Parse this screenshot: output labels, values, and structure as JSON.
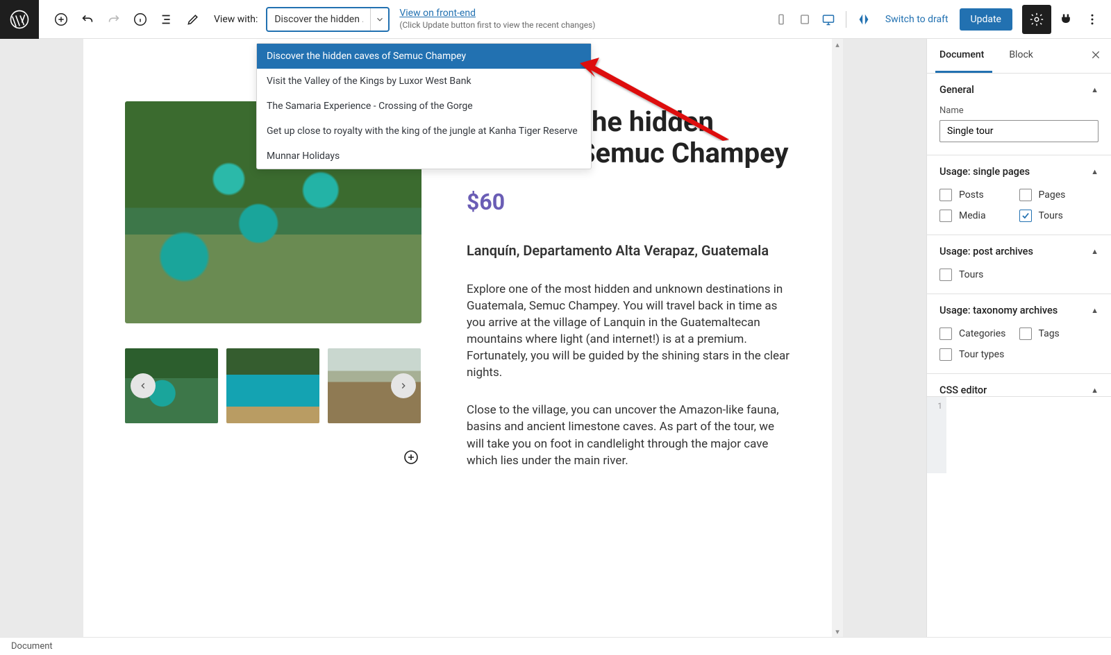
{
  "toolbar": {
    "view_with_label": "View with:",
    "combo_value": "Discover the hidden …",
    "view_frontend": "View on front-end",
    "view_hint": "(Click Update button first to view the recent changes)",
    "switch_draft": "Switch to draft",
    "update": "Update"
  },
  "dropdown": {
    "options": [
      "Discover the hidden caves of Semuc Champey",
      "Visit the Valley of the Kings by Luxor West Bank",
      "The Samaria Experience - Crossing of the Gorge",
      "Get up close to royalty with the king of the jungle at Kanha Tiger Reserve",
      "Munnar Holidays"
    ],
    "selected_index": 0
  },
  "content": {
    "title": "Discover the hidden caves of Semuc Champey",
    "price": "$60",
    "location": "Lanquín, Departamento Alta Verapaz, Guatemala",
    "para1": "Explore one of the most hidden and unknown destinations in Guatemala, Semuc Champey. You will travel back in time as you arrive at the village of Lanquin in the Guatemaltecan mountains where light (and internet!) is at a premium. Fortunately, you will be guided by the shining stars in the clear nights.",
    "para2": "Close to the village, you can uncover the Amazon-like fauna, basins and ancient limestone caves. As part of the tour, we will take you on foot in candlelight through the major cave which lies under the main river."
  },
  "sidebar": {
    "tabs": {
      "document": "Document",
      "block": "Block"
    },
    "general": {
      "title": "General",
      "name_label": "Name",
      "name_value": "Single tour"
    },
    "usage_single": {
      "title": "Usage: single pages",
      "posts": "Posts",
      "pages": "Pages",
      "media": "Media",
      "tours": "Tours"
    },
    "usage_post": {
      "title": "Usage: post archives",
      "tours": "Tours"
    },
    "usage_taxonomy": {
      "title": "Usage: taxonomy archives",
      "categories": "Categories",
      "tags": "Tags",
      "tour_types": "Tour types"
    },
    "css_editor": {
      "title": "CSS editor",
      "line_no": "1"
    }
  },
  "breadcrumb": "Document"
}
